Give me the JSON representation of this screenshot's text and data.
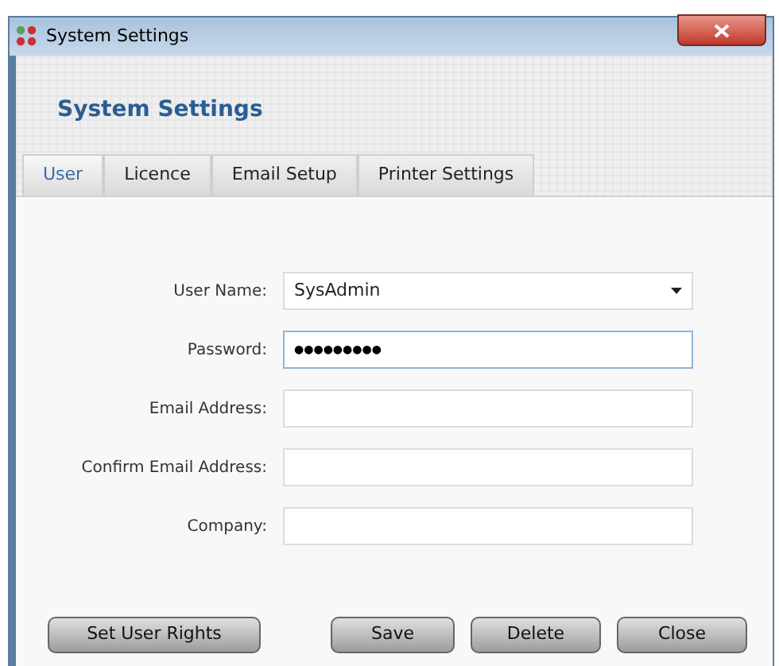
{
  "window": {
    "title": "System Settings"
  },
  "header": {
    "title": "System Settings"
  },
  "tabs": [
    {
      "label": "User",
      "selected": true
    },
    {
      "label": "Licence",
      "selected": false
    },
    {
      "label": "Email Setup",
      "selected": false
    },
    {
      "label": "Printer Settings",
      "selected": false
    }
  ],
  "fields": [
    {
      "label": "User Name:",
      "kind": "select",
      "value": "SysAdmin",
      "focused": false
    },
    {
      "label": "Password:",
      "kind": "text",
      "value": "●●●●●●●●●",
      "focused": true
    },
    {
      "label": "Email Address:",
      "kind": "text",
      "focused": false
    },
    {
      "label": "Confirm Email Address:",
      "kind": "text",
      "focused": false
    },
    {
      "label": "Company:",
      "kind": "text",
      "focused": false
    }
  ],
  "buttons_left": [
    "Set User Rights"
  ],
  "buttons_right": [
    "Save",
    "Delete",
    "Close"
  ]
}
